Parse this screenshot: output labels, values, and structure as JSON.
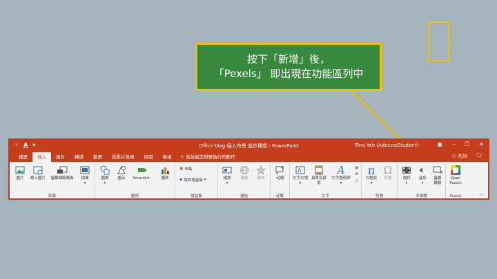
{
  "callout": {
    "line1": "按下「新增」後，",
    "line2": "「Pexels」 即出現在功能區列中"
  },
  "window": {
    "title": "Office blog-插入布景 設計構想 - PowerPoint",
    "user": "Tina Yeh (Adecco/Student)",
    "share": "共用",
    "tell_me": "告訴我您想要執行的動作"
  },
  "tabs": [
    "檔案",
    "插入",
    "設計",
    "轉場",
    "動畫",
    "投影片放映",
    "校閱",
    "檢視"
  ],
  "groups": {
    "images": {
      "label": "影像",
      "buttons": [
        "圖片",
        "線上圖片",
        "螢幕擷取畫面",
        "相簿"
      ]
    },
    "illustrations": {
      "label": "圖例",
      "buttons": [
        "圖案",
        "圖示",
        "SmartArt...",
        "圖表"
      ]
    },
    "addins": {
      "label": "增益集",
      "store": "市集",
      "my_addins": "我的增益集"
    },
    "links": {
      "label": "連結",
      "buttons": [
        "縮放",
        "連結",
        "動作"
      ]
    },
    "comments": {
      "label": "註解",
      "buttons": [
        "註解"
      ]
    },
    "text": {
      "label": "文字",
      "buttons": [
        "文字方塊",
        "頁首及頁尾",
        "文字藝術師"
      ]
    },
    "symbols": {
      "label": "符號",
      "buttons": [
        "方程式",
        "符號"
      ]
    },
    "media": {
      "label": "多媒體",
      "buttons": [
        "視訊",
        "音訊",
        "螢幕錄製"
      ]
    },
    "pexels": {
      "label": "Pexels",
      "button": "Open Pexels"
    }
  },
  "colors": {
    "accent": "#c43e1c",
    "callout_bg": "#378a3d",
    "highlight": "#f2c200",
    "backdrop": "#a5b4bc"
  }
}
